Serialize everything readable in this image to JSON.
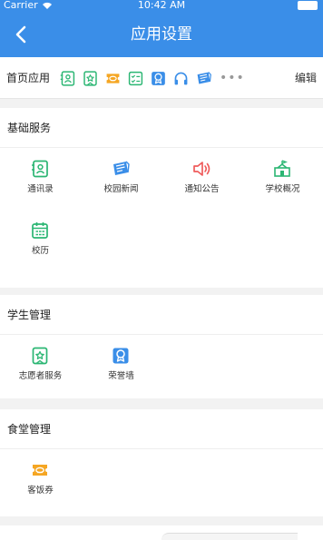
{
  "status_bar": {
    "carrier": "Carrier",
    "time": "10:42 AM"
  },
  "nav": {
    "title": "应用设置"
  },
  "home_apps": {
    "label": "首页应用",
    "more": "•••",
    "edit_label": "编辑"
  },
  "sections": [
    {
      "title": "基础服务",
      "items": [
        {
          "label": "通讯录",
          "icon": "contacts-icon",
          "color": "#2bb673"
        },
        {
          "label": "校园新闻",
          "icon": "news-icon",
          "color": "#3a8ee8"
        },
        {
          "label": "通知公告",
          "icon": "speaker-icon",
          "color": "#ef5b5b"
        },
        {
          "label": "学校概况",
          "icon": "school-icon",
          "color": "#2bb673"
        },
        {
          "label": "校历",
          "icon": "calendar-icon",
          "color": "#2bb673"
        }
      ]
    },
    {
      "title": "学生管理",
      "items": [
        {
          "label": "志愿者服务",
          "icon": "volunteer-icon",
          "color": "#2bb673"
        },
        {
          "label": "荣誉墙",
          "icon": "honor-icon",
          "color": "#3a8ee8"
        }
      ]
    },
    {
      "title": "食堂管理",
      "items": [
        {
          "label": "客饭券",
          "icon": "meal-ticket-icon",
          "color": "#f5a623"
        }
      ]
    }
  ],
  "home_icon_list": [
    {
      "icon": "contacts-icon",
      "color": "#2bb673"
    },
    {
      "icon": "volunteer-icon",
      "color": "#2bb673"
    },
    {
      "icon": "meal-ticket-icon",
      "color": "#f5a623"
    },
    {
      "icon": "checklist-icon",
      "color": "#2bb673"
    },
    {
      "icon": "honor-icon",
      "color": "#3a8ee8"
    },
    {
      "icon": "headphones-icon",
      "color": "#3a8ee8"
    },
    {
      "icon": "news-icon",
      "color": "#3a8ee8"
    }
  ],
  "colors": {
    "nav_bg": "#3a8ee8",
    "page_bg": "#f2f2f2"
  }
}
